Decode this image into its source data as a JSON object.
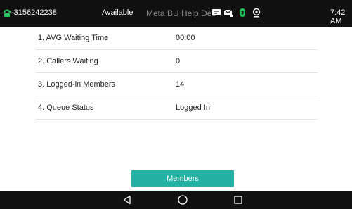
{
  "status_bar": {
    "phone_icon": "phone-handset-icon",
    "number": "-3156242238",
    "availability": "Available",
    "app_title": "Meta BU Help Des",
    "icons": [
      "voicemail-icon",
      "message-icon",
      "bluetooth-icon",
      "location-pin-icon"
    ],
    "time": "7:42 AM",
    "accent_color": "#22c55e"
  },
  "queue_info": {
    "rows": [
      {
        "label": "1. AVG.Waiting Time",
        "value": "00:00"
      },
      {
        "label": "2. Callers Waiting",
        "value": "0"
      },
      {
        "label": "3. Logged-in Members",
        "value": "14"
      },
      {
        "label": "4. Queue Status",
        "value": "Logged In"
      }
    ]
  },
  "members_button": {
    "label": "Members",
    "color": "#23b2a3"
  },
  "nav_bar": {
    "icons": [
      "back-triangle-icon",
      "home-circle-icon",
      "recents-square-icon"
    ]
  }
}
